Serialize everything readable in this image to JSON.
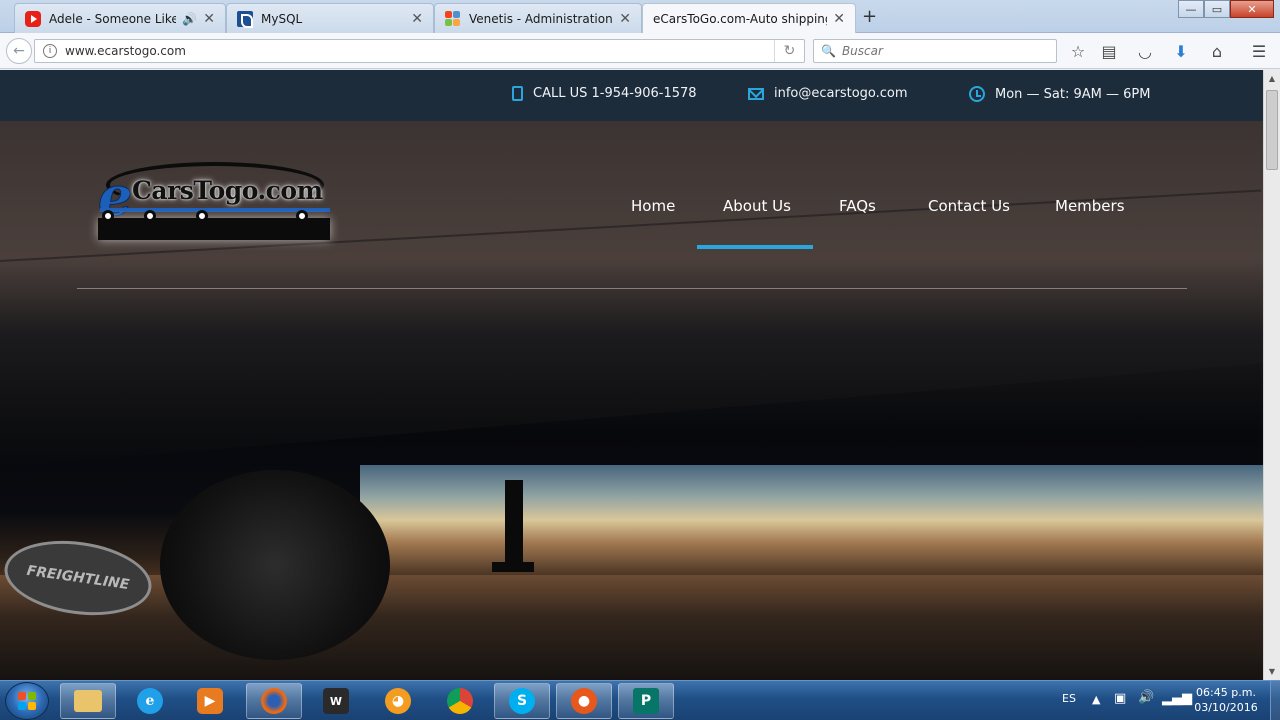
{
  "browser": {
    "tabs": [
      {
        "title": "Adele - Someone Like ...",
        "icon": "youtube-icon",
        "audio": true
      },
      {
        "title": "MySQL",
        "icon": "mysql-icon",
        "audio": false
      },
      {
        "title": "Venetis - Administration - ...",
        "icon": "joomla-icon",
        "audio": false
      },
      {
        "title": "eCarsToGo.com-Auto shipping...",
        "icon": "site-icon",
        "audio": false,
        "active": true
      }
    ],
    "new_tab_label": "+",
    "url": "www.ecarstogo.com",
    "search_placeholder": "Buscar",
    "window_buttons": {
      "minimize": "—",
      "maximize": "▭",
      "close": "✕"
    }
  },
  "site": {
    "topbar": {
      "phone": "CALL US 1-954-906-1578",
      "email": "info@ecarstogo.com",
      "hours": "Mon — Sat: 9AM — 6PM"
    },
    "logo": {
      "e": "e",
      "text": "CarsTogo.com"
    },
    "nav": [
      {
        "label": "Home"
      },
      {
        "label": "About Us",
        "active": true
      },
      {
        "label": "FAQs"
      },
      {
        "label": "Contact Us"
      },
      {
        "label": "Members"
      }
    ],
    "hero": {
      "badge_text": "FREIGHTLINE"
    },
    "accent_color": "#2aa6e0"
  },
  "taskbar": {
    "apps": [
      {
        "name": "explorer-icon"
      },
      {
        "name": "internet-explorer-icon"
      },
      {
        "name": "media-player-icon"
      },
      {
        "name": "firefox-icon",
        "active": true
      },
      {
        "name": "world-of-tanks-icon"
      },
      {
        "name": "scratch-icon"
      },
      {
        "name": "chrome-icon"
      },
      {
        "name": "skype-icon"
      },
      {
        "name": "orange-app-icon"
      },
      {
        "name": "publisher-icon"
      }
    ],
    "language": "ES",
    "time": "06:45 p.m.",
    "date": "03/10/2016"
  }
}
